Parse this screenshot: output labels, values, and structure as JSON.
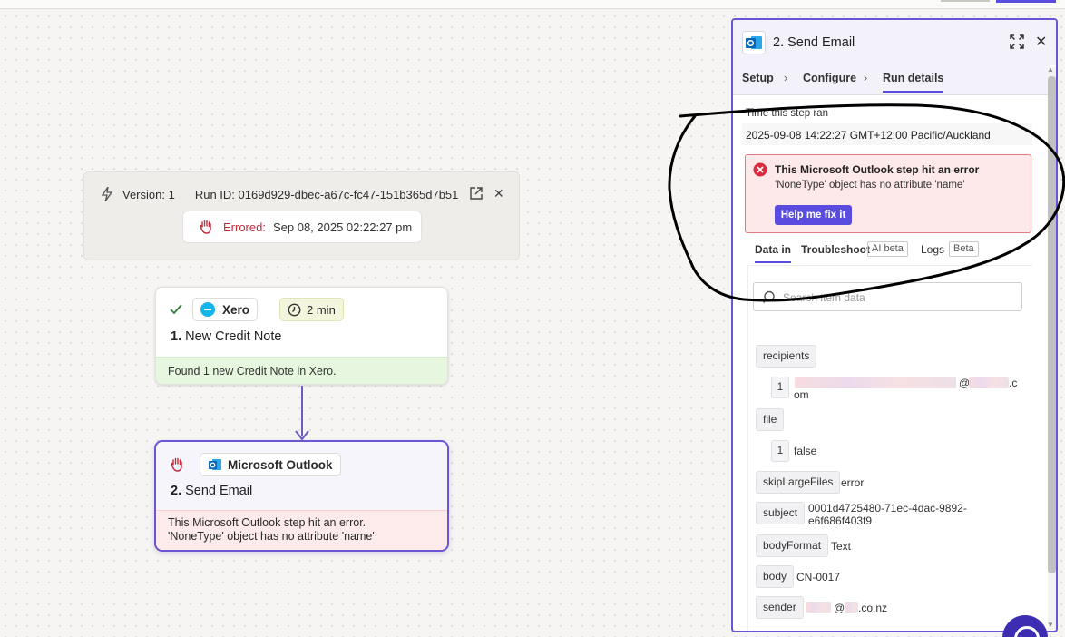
{
  "run_info": {
    "version": "Version: 1",
    "run_id": "Run ID: 0169d929-dbec-a67c-fc47-151b365d7b51",
    "status_label": "Errored:",
    "status_time": "Sep 08, 2025 02:22:27 pm"
  },
  "step1": {
    "app": "Xero",
    "duration": "2 min",
    "number": "1.",
    "title": "New Credit Note",
    "footer": "Found 1 new Credit Note in Xero."
  },
  "step2": {
    "app": "Microsoft Outlook",
    "number": "2.",
    "title": "Send Email",
    "footer_line1": "This Microsoft Outlook step hit an error.",
    "footer_line2": "'NoneType' object has no attribute 'name'"
  },
  "panel": {
    "title": "2. Send Email",
    "tabs": {
      "setup": "Setup",
      "configure": "Configure",
      "run_details": "Run details"
    },
    "time_label": "Time this step ran",
    "time_value": "2025-09-08 14:22:27 GMT+12:00 Pacific/Auckland",
    "error": {
      "heading": "This Microsoft Outlook step hit an error",
      "message": "'NoneType' object has no attribute 'name'",
      "fix_button": "Help me fix it"
    },
    "data_tabs": {
      "data_in": "Data in",
      "troubleshoot": "Troubleshoot",
      "ai_badge": "AI beta",
      "logs": "Logs",
      "beta_badge": "Beta"
    },
    "search_placeholder": "Search item data",
    "fields": {
      "recipients": {
        "key": "recipients",
        "index": "1",
        "value_tail": "@",
        "value_end": ".c",
        "value_wrap": "om"
      },
      "file": {
        "key": "file",
        "index": "1",
        "value": "false"
      },
      "skip_large_files": {
        "key": "skipLargeFiles",
        "value": "error"
      },
      "subject": {
        "key": "subject",
        "value_line1": "0001d4725480-71ec-4dac-9892-",
        "value_line2": "e6f686f403f9"
      },
      "body_format": {
        "key": "bodyFormat",
        "value": "Text"
      },
      "body": {
        "key": "body",
        "value": "CN-0017"
      },
      "sender": {
        "key": "sender",
        "value_at": "@",
        "value_domain": ".co.nz"
      }
    }
  },
  "colors": {
    "accent": "#5b4ce0",
    "error": "#c22a3a",
    "success_bg": "#e6f6df",
    "error_bg": "#fdeaea",
    "annotation": "#000000"
  },
  "icons": [
    "bolt-icon",
    "external-link-icon",
    "close-icon",
    "hand-stop-icon",
    "check-icon",
    "xero-logo-icon",
    "clock-icon",
    "outlook-logo-icon",
    "expand-icon",
    "chevron-right-icon",
    "error-x-icon",
    "search-icon",
    "chat-icon"
  ]
}
